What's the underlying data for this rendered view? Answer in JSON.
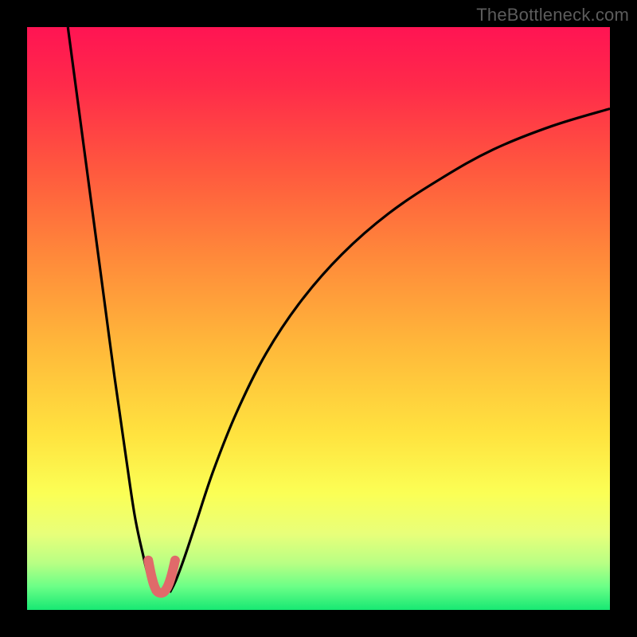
{
  "watermark": "TheBottleneck.com",
  "chart_data": {
    "type": "line",
    "title": "",
    "xlabel": "",
    "ylabel": "",
    "xlim": [
      0,
      100
    ],
    "ylim": [
      0,
      100
    ],
    "grid": false,
    "legend": false,
    "series": [
      {
        "name": "left-descent",
        "x": [
          7,
          9,
          11,
          13,
          15,
          17,
          18.5,
          20,
          21,
          21.7
        ],
        "values": [
          100,
          85,
          70,
          55,
          40,
          26,
          16,
          9,
          5,
          3
        ]
      },
      {
        "name": "right-ascent",
        "x": [
          24.5,
          25.5,
          27,
          29,
          32,
          36,
          41,
          47,
          54,
          62,
          71,
          80,
          90,
          100
        ],
        "values": [
          3,
          5,
          9,
          15,
          24,
          34,
          44,
          53,
          61,
          68,
          74,
          79,
          83,
          86
        ]
      },
      {
        "name": "valley-marker",
        "x": [
          20.8,
          21.3,
          21.8,
          22.3,
          23.0,
          23.6,
          24.2,
          24.8,
          25.4
        ],
        "values": [
          8.5,
          6.0,
          4.2,
          3.2,
          2.9,
          3.2,
          4.2,
          6.0,
          8.5
        ]
      }
    ],
    "gradient_stops": [
      {
        "offset": 0.0,
        "color": "#ff1453"
      },
      {
        "offset": 0.1,
        "color": "#ff2a4a"
      },
      {
        "offset": 0.25,
        "color": "#ff5a3e"
      },
      {
        "offset": 0.4,
        "color": "#ff8b3a"
      },
      {
        "offset": 0.55,
        "color": "#ffb93a"
      },
      {
        "offset": 0.7,
        "color": "#ffe33f"
      },
      {
        "offset": 0.8,
        "color": "#fbff55"
      },
      {
        "offset": 0.87,
        "color": "#e8ff7a"
      },
      {
        "offset": 0.92,
        "color": "#b8ff84"
      },
      {
        "offset": 0.96,
        "color": "#6bff87"
      },
      {
        "offset": 1.0,
        "color": "#17e873"
      }
    ],
    "valley_marker_color": "#e06a6a"
  }
}
